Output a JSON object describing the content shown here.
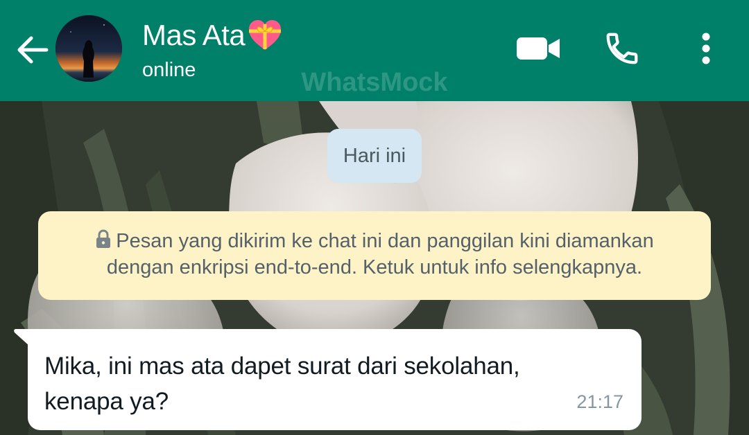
{
  "header": {
    "back_icon": "arrow-left-icon",
    "avatar_icon": "profile-photo",
    "contact_name": "Mas Ata",
    "name_emoji": "heart-with-ribbon-emoji",
    "status": "online",
    "watermark": "WhatsMock",
    "actions": [
      "video-call-icon",
      "phone-icon",
      "more-vert-icon"
    ],
    "background_color": "#008069"
  },
  "chat": {
    "date_chip": "Hari ini",
    "encryption_notice": "Pesan yang dikirim ke chat ini dan panggilan kini diamankan dengan enkripsi end-to-end. Ketuk untuk info selengkapnya.",
    "encryption_icon": "lock-icon",
    "messages": [
      {
        "direction": "incoming",
        "text": "Mika, ini mas ata dapet surat dari sekolahan, kenapa ya?",
        "time": "21:17"
      }
    ]
  }
}
